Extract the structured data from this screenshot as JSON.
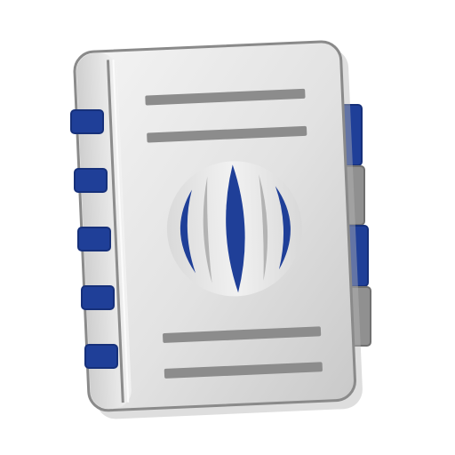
{
  "icon": {
    "name": "address-book-icon",
    "colors": {
      "accent_blue": "#1f3f98",
      "tab_gray": "#8f8f8f",
      "cover_light": "#f0f0f0",
      "cover_dark": "#bfbfbf",
      "outline": "#8a8a8a",
      "line_gray": "#8c8c8c"
    }
  }
}
